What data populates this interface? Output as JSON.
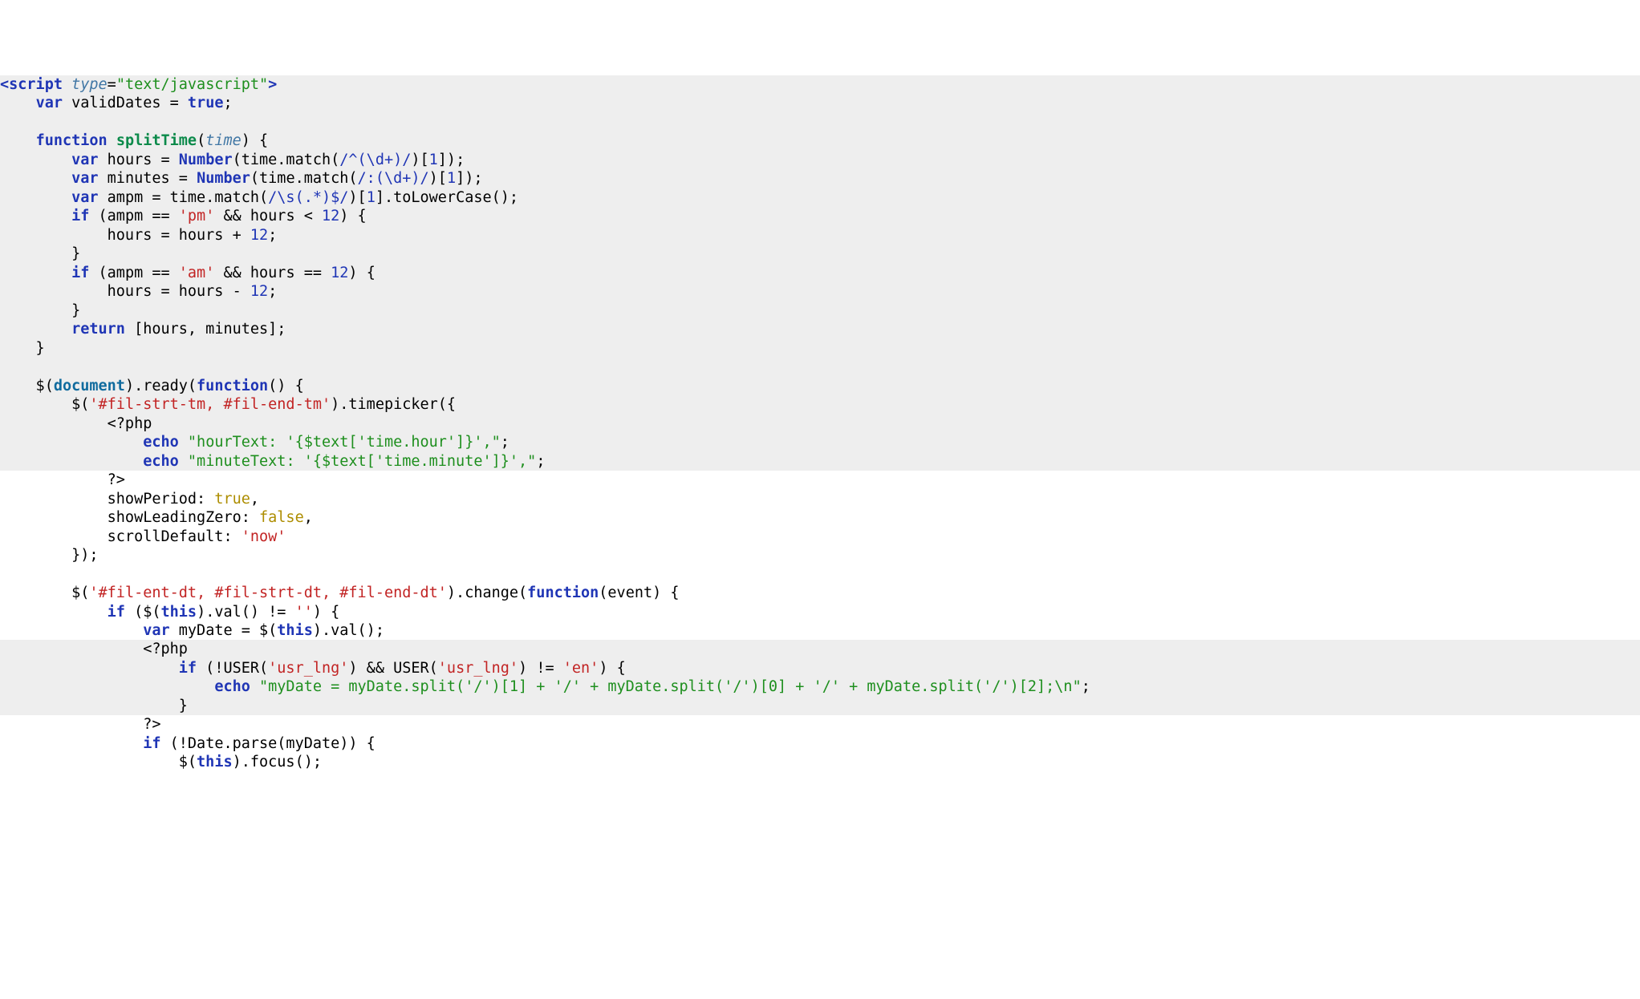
{
  "lang": "php+javascript",
  "highlighted_group_bg": "#eeeeee",
  "tokens_in_reading_order": [
    "<script type=\"text/javascript\">",
    "var validDates = true;",
    "function splitTime(time) {",
    "var hours = Number(time.match(/^(\\d+)/)[1]);",
    "var minutes = Number(time.match(/:(\\d+)/)[1]);",
    "var ampm = time.match(/\\s(.*)$/)[1].toLowerCase();",
    "if (ampm == 'pm' && hours < 12) {",
    "hours = hours + 12;",
    "}",
    "if (ampm == 'am' && hours == 12) {",
    "hours = hours - 12;",
    "}",
    "return [hours, minutes];",
    "}",
    "$(document).ready(function() {",
    "$('#fil-strt-tm, #fil-end-tm').timepicker({",
    "<?php",
    "echo \"hourText: '{$text['time.hour']}',\";",
    "echo \"minuteText: '{$text['time.minute']}',\";",
    "?>",
    "showPeriod: true,",
    "showLeadingZero: false,",
    "scrollDefault: 'now'",
    "});",
    "$('#fil-ent-dt, #fil-strt-dt, #fil-end-dt').change(function(event) {",
    "if ($(this).val() != '') {",
    "var myDate = $(this).val();",
    "<?php",
    "if (!USER('usr_lng') && USER('usr_lng') != 'en') {",
    "echo \"myDate = myDate.split('/')[1] + '/' + myDate.split('/')[0] + '/' + myDate.split('/')[2];\\n\";",
    "}",
    "?>",
    "if (!Date.parse(myDate)) {",
    "$(this).focus();"
  ],
  "lines": [
    {
      "hl": true,
      "html": "<span class='tag'>&lt;script</span> <span class='attr'>type</span>=<span class='strG'>\"text/javascript\"</span><span class='tag'>&gt;</span>"
    },
    {
      "hl": true,
      "html": "    <span class='kw'>var</span> validDates = <span class='boolT'>true</span>;"
    },
    {
      "hl": true,
      "html": ""
    },
    {
      "hl": true,
      "html": "    <span class='kw'>function</span> <span class='fnN'>splitTime</span>(<span class='attr'>time</span>) {"
    },
    {
      "hl": true,
      "html": "        <span class='kw'>var</span> hours = <span class='kw'>Number</span>(time.match(<span class='regex'>/^(\\d+)/</span>)[<span class='num'>1</span>]);"
    },
    {
      "hl": true,
      "html": "        <span class='kw'>var</span> minutes = <span class='kw'>Number</span>(time.match(<span class='regex'>/:(\\d+)/</span>)[<span class='num'>1</span>]);"
    },
    {
      "hl": true,
      "html": "        <span class='kw'>var</span> ampm = time.match(<span class='regex'>/\\s(.*)$/</span>)[<span class='num'>1</span>].toLowerCase();"
    },
    {
      "hl": true,
      "html": "        <span class='kw'>if</span> (ampm == <span class='strR'>'pm'</span> &amp;&amp; hours &lt; <span class='num'>12</span>) {"
    },
    {
      "hl": true,
      "html": "            hours = hours + <span class='num'>12</span>;"
    },
    {
      "hl": true,
      "html": "        }"
    },
    {
      "hl": true,
      "html": "        <span class='kw'>if</span> (ampm == <span class='strR'>'am'</span> &amp;&amp; hours == <span class='num'>12</span>) {"
    },
    {
      "hl": true,
      "html": "            hours = hours - <span class='num'>12</span>;"
    },
    {
      "hl": true,
      "html": "        }"
    },
    {
      "hl": true,
      "html": "        <span class='kw'>return</span> [hours, minutes];"
    },
    {
      "hl": true,
      "html": "    }"
    },
    {
      "hl": true,
      "html": ""
    },
    {
      "hl": true,
      "html": "    $(<span class='id'>document</span>).ready(<span class='kw'>function</span>() {"
    },
    {
      "hl": true,
      "html": "        $(<span class='strR'>'#fil-strt-tm, #fil-end-tm'</span>).timepicker({"
    },
    {
      "hl": true,
      "html": "            &lt;?php"
    },
    {
      "hl": true,
      "html": "                <span class='kw'>echo</span> <span class='strG'>\"hourText: '{$text['time.hour']}',\"</span>;"
    },
    {
      "hl": true,
      "html": "                <span class='kw'>echo</span> <span class='strG'>\"minuteText: '{$text['time.minute']}',\"</span>;"
    },
    {
      "hl": false,
      "html": "            ?&gt;"
    },
    {
      "hl": false,
      "html": "            showPeriod: <span class='fnC'>true</span>,"
    },
    {
      "hl": false,
      "html": "            showLeadingZero: <span class='fnC'>false</span>,"
    },
    {
      "hl": false,
      "html": "            scrollDefault: <span class='strR'>'now'</span>"
    },
    {
      "hl": false,
      "html": "        });"
    },
    {
      "hl": false,
      "html": ""
    },
    {
      "hl": false,
      "html": "        $(<span class='strR'>'#fil-ent-dt, #fil-strt-dt, #fil-end-dt'</span>).change(<span class='kw'>function</span>(event) {"
    },
    {
      "hl": false,
      "html": "            <span class='kw'>if</span> ($(<span class='kw'>this</span>).val() != <span class='strR'>''</span>) {"
    },
    {
      "hl": false,
      "html": "                <span class='kw'>var</span> myDate = $(<span class='kw'>this</span>).val();"
    },
    {
      "hl": true,
      "html": "                &lt;?php"
    },
    {
      "hl": true,
      "html": "                    <span class='kw'>if</span> (!USER(<span class='strR'>'usr_lng'</span>) &amp;&amp; USER(<span class='strR'>'usr_lng'</span>) != <span class='strR'>'en'</span>) {"
    },
    {
      "hl": true,
      "html": "                        <span class='kw'>echo</span> <span class='strG'>\"myDate = myDate.split('/')[1] + '/' + myDate.split('/')[0] + '/' + myDate.split('/')[2];\\n\"</span>;"
    },
    {
      "hl": true,
      "html": "                    }"
    },
    {
      "hl": false,
      "html": "                ?&gt;"
    },
    {
      "hl": false,
      "html": "                <span class='kw'>if</span> (!Date.parse(myDate)) {"
    },
    {
      "hl": false,
      "html": "                    $(<span class='kw'>this</span>).focus();"
    }
  ]
}
